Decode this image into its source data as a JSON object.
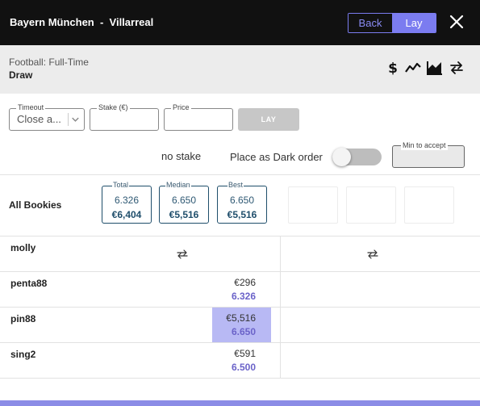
{
  "header": {
    "match": "Bayern München  -  Villarreal",
    "back_label": "Back",
    "lay_label": "Lay"
  },
  "market": {
    "type": "Football: Full-Time",
    "selection": "Draw"
  },
  "toolbar": {
    "icons": [
      "dollar-icon",
      "line-chart-icon",
      "area-chart-icon",
      "swap-icon"
    ]
  },
  "form": {
    "timeout_label": "Timeout",
    "timeout_value": "Close a...",
    "stake_label": "Stake (€)",
    "stake_value": "",
    "price_label": "Price",
    "price_value": "",
    "lay_button": "LAY",
    "stake_status": "no stake",
    "dark_order_label": "Place as Dark order",
    "dark_order_enabled": false,
    "min_accept_label": "Min to accept",
    "min_accept_value": ""
  },
  "summary": {
    "label": "All Bookies",
    "total": {
      "label": "Total",
      "odds": "6.326",
      "amount": "€6,404"
    },
    "median": {
      "label": "Median",
      "odds": "6.650",
      "amount": "€5,516"
    },
    "best": {
      "label": "Best",
      "odds": "6.650",
      "amount": "€5,516"
    }
  },
  "rows": [
    {
      "name": "molly",
      "amount": "",
      "odds": ""
    },
    {
      "name": "penta88",
      "amount": "€296",
      "odds": "6.326"
    },
    {
      "name": "pin88",
      "amount": "€5,516",
      "odds": "6.650",
      "highlighted": true
    },
    {
      "name": "sing2",
      "amount": "€591",
      "odds": "6.500"
    }
  ],
  "colors": {
    "accent": "#7b7cf0",
    "header_bg": "#111111",
    "highlight": "#b8b9f4",
    "odds_text": "#6b63c9"
  }
}
